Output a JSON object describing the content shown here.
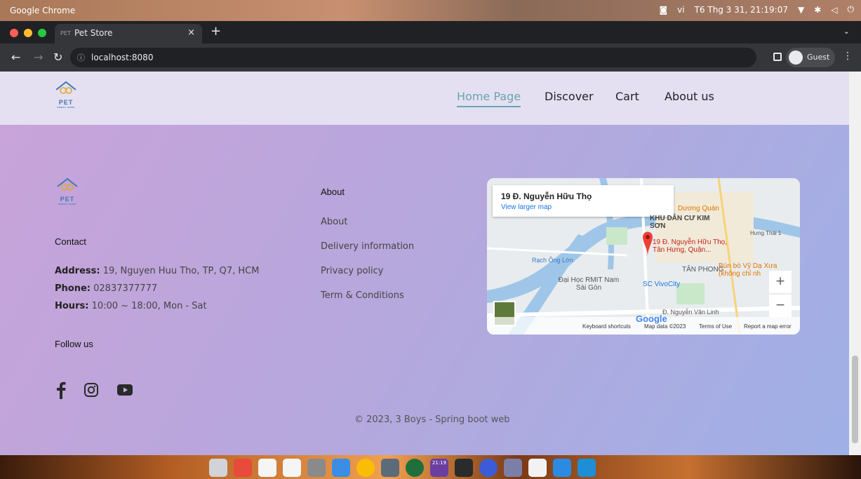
{
  "os": {
    "title": "Google Chrome",
    "lang": "vi",
    "clock": "T6 Thg 3 31, 21:19:07"
  },
  "browser": {
    "tab_title": "Pet Store",
    "tab_favicon": "PET",
    "url": "localhost:8080",
    "profile": "Guest"
  },
  "header": {
    "logo_text": "PET",
    "logo_sub": "SWEET HOME",
    "nav": [
      "Home Page",
      "Discover",
      "Cart",
      "About us"
    ]
  },
  "footer": {
    "logo_text": "PET",
    "logo_sub": "SWEET HOME",
    "contact_title": "Contact",
    "address_label": "Address:",
    "address": "19, Nguyen Huu Tho, TP, Q7, HCM",
    "phone_label": "Phone:",
    "phone": "02837377777",
    "hours_label": "Hours:",
    "hours": "10:00 ~ 18:00, Mon - Sat",
    "follow_title": "Follow us",
    "social": [
      "facebook-icon",
      "instagram-icon",
      "youtube-icon"
    ],
    "about_title": "About",
    "about_links": [
      "About",
      "Delivery information",
      "Privacy policy",
      "Term & Conditions"
    ],
    "copyright": "© 2023, 3 Boys - Spring boot web"
  },
  "map": {
    "place": "19 Đ. Nguyễn Hữu Thọ",
    "view_larger": "View larger map",
    "pin_label": "19 Đ. Nguyễn Hữu Thọ, Tân Hưng, Quận...",
    "labels": [
      "Dương Quán",
      "KHU DÂN CƯ KIM SƠN",
      "TÂN PHONG",
      "Bún bò Vỹ Dạ Xưa (không chỉ nh",
      "SC VivoCity",
      "Đại Học RMIT Nam Sài Gòn",
      "Đ. Nguyễn Văn Linh",
      "Rạch Ông Lớn",
      "Hưng Thái 1"
    ],
    "google": "Google",
    "attributions": [
      "Keyboard shortcuts",
      "Map data ©2023",
      "Terms of Use",
      "Report a map error"
    ]
  },
  "dock": {
    "clock_top": "21:19",
    "clock_sub": "Thg 3 31"
  }
}
